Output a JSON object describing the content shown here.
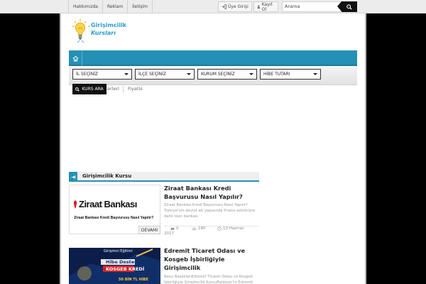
{
  "topbar": {
    "links": [
      "Hakkımızda",
      "Reklam",
      "İletişim"
    ],
    "login_label": "Üye Girişi",
    "register_label": "Kayıt Ol",
    "search_placeholder": "Arama"
  },
  "logo": {
    "line1": "Girişimcilik",
    "line2": "Kursları"
  },
  "filters": {
    "il": "İL SEÇİNİZ",
    "ilce": "İLÇE SEÇİNİZ",
    "kurum": "KURUM SEÇİNİZ",
    "hibe": "HİBE TUTARI",
    "search_button": "KURS ARA"
  },
  "subnav": {
    "item1": "erleri",
    "item2": "Fiyatis"
  },
  "section": {
    "title": "Girişimcilik Kursu"
  },
  "posts": [
    {
      "thumb_brand": "Ziraat Bankası",
      "thumb_caption": "Ziraat Bankası Kredi Başvurusu Nasıl Yapılır?",
      "title": "Ziraat Bankası Kredi Başvurusu Nasıl Yapılır?",
      "excerpt": "Ziraat Bankası Kredi Başvurusu Nasıl Yapılır? Türkiye'nin devlet alt yapısında finans sektörüne dahil olan bankası",
      "comments": "0",
      "views": "180",
      "date": "13 Haziran",
      "year": "2017",
      "more_label": "DEVAMI"
    },
    {
      "thumb_top": "Girişimci Eğitimi",
      "thumb_mid": "Hibe Desteği",
      "thumb_band": "KOSGEB KREDİ",
      "thumb_bottom": "50 BİN TL HİBE",
      "title": "Edremit Ticaret Odası ve Kosgeb İşbirliğiyle Girişimcilik",
      "excerpt": "Konu BaşlıklarıEdremit Ticaret Odası ve Kosgeb İşbirliğiyle Girişimcilik KursuBalıkesir'in Edremit"
    }
  ],
  "colors": {
    "accent": "#2590b5",
    "dark": "#111111",
    "page_bg": "#000000"
  }
}
